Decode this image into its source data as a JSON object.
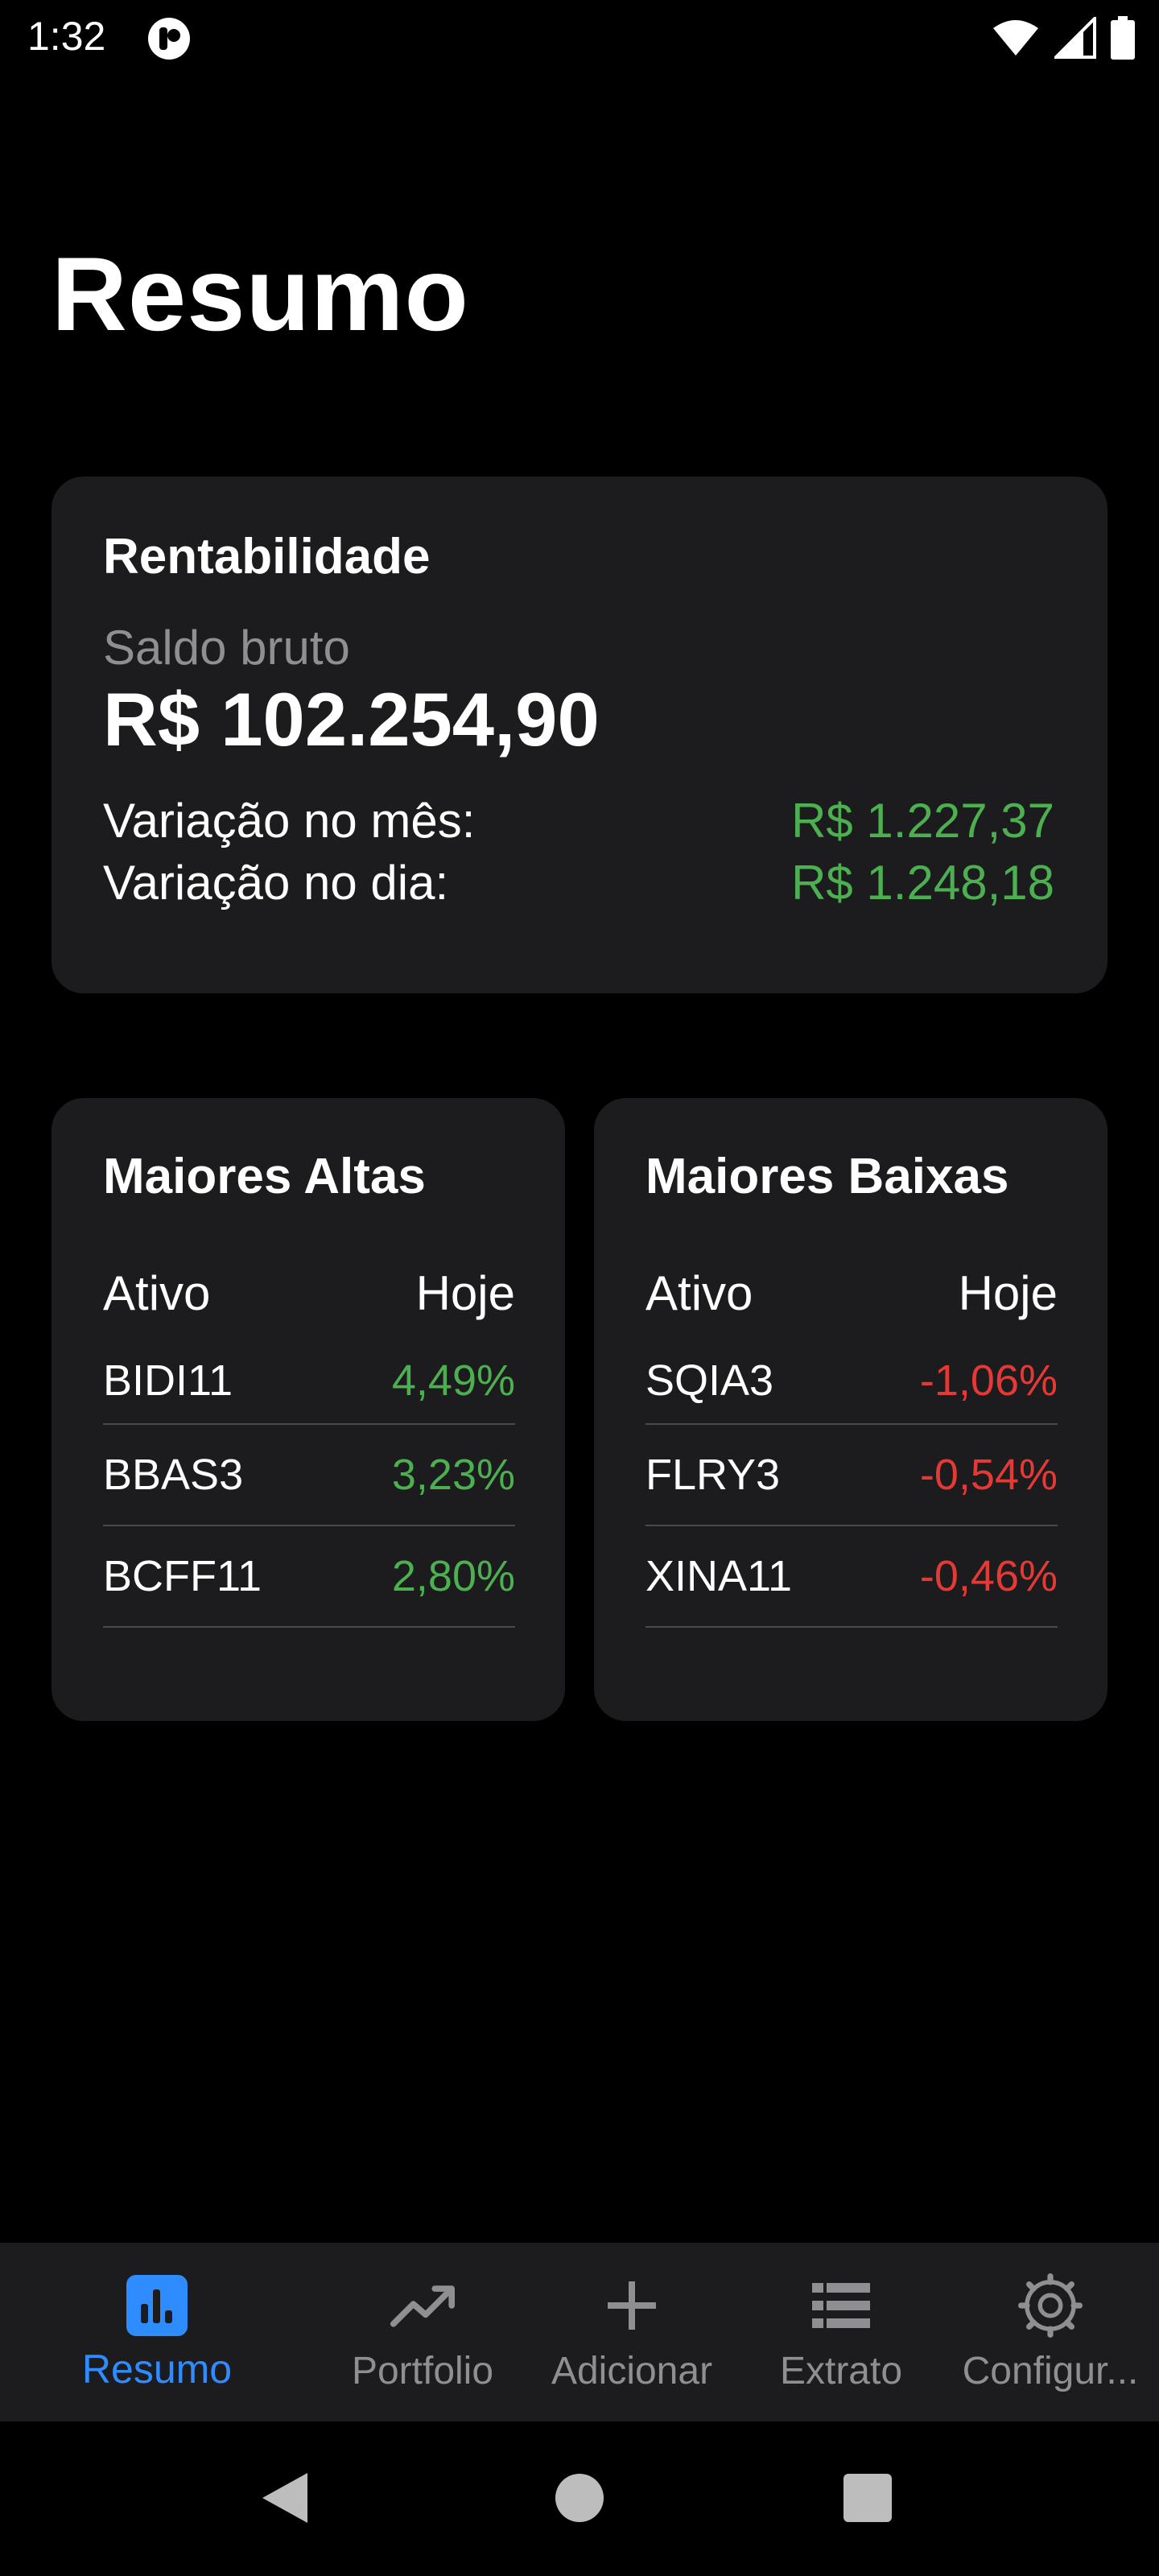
{
  "status_bar": {
    "time": "1:32",
    "icons": [
      "app-notification-icon",
      "wifi-icon",
      "signal-icon",
      "battery-icon"
    ]
  },
  "page": {
    "title": "Resumo"
  },
  "summary_card": {
    "title": "Rentabilidade",
    "subtitle": "Saldo bruto",
    "balance": "R$ 102.254,90",
    "month_label": "Variação no mês:",
    "month_value": "R$ 1.227,37",
    "day_label": "Variação no dia:",
    "day_value": "R$ 1.248,18"
  },
  "top_gainers": {
    "title": "Maiores Altas",
    "col_asset": "Ativo",
    "col_today": "Hoje",
    "rows": [
      {
        "asset": "BIDI11",
        "change": "4,49%"
      },
      {
        "asset": "BBAS3",
        "change": "3,23%"
      },
      {
        "asset": "BCFF11",
        "change": "2,80%"
      }
    ]
  },
  "top_losers": {
    "title": "Maiores Baixas",
    "col_asset": "Ativo",
    "col_today": "Hoje",
    "rows": [
      {
        "asset": "SQIA3",
        "change": "-1,06%"
      },
      {
        "asset": "FLRY3",
        "change": "-0,54%"
      },
      {
        "asset": "XINA11",
        "change": "-0,46%"
      }
    ]
  },
  "bottom_nav": {
    "items": [
      {
        "label": "Resumo",
        "icon": "bar-chart-icon",
        "active": true
      },
      {
        "label": "Portfolio",
        "icon": "trending-up-icon",
        "active": false
      },
      {
        "label": "Adicionar",
        "icon": "plus-icon",
        "active": false
      },
      {
        "label": "Extrato",
        "icon": "list-icon",
        "active": false
      },
      {
        "label": "Configur...",
        "icon": "settings-icon",
        "active": false
      }
    ]
  },
  "system_nav": {
    "buttons": [
      "back-icon",
      "home-icon",
      "recents-icon"
    ]
  },
  "colors": {
    "background": "#000000",
    "card": "#1c1c1e",
    "positive": "#4caf50",
    "negative": "#e53935",
    "accent": "#2f8cff",
    "muted": "#8e8e93"
  }
}
